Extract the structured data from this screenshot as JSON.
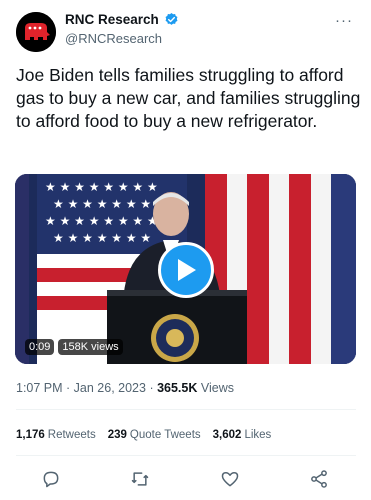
{
  "account": {
    "name": "RNC Research",
    "handle": "@RNCResearch",
    "verified": true,
    "avatar_icon": "gop-elephant-icon",
    "avatar_color": "#e0232b"
  },
  "more_menu": "···",
  "tweet": {
    "text": "Joe Biden tells families struggling to afford gas to buy a new car, and families struggling to afford food to buy a new refrigerator."
  },
  "video": {
    "duration": "0:09",
    "views": "158K views"
  },
  "meta": {
    "time": "1:07 PM",
    "sep1": " · ",
    "date": "Jan 26, 2023",
    "sep2": " · ",
    "views_count": "365.5K",
    "views_label": " Views"
  },
  "stats": [
    {
      "count": "1,176",
      "label": "Retweets"
    },
    {
      "count": "239",
      "label": "Quote Tweets"
    },
    {
      "count": "3,602",
      "label": "Likes"
    }
  ],
  "actions": [
    "reply-icon",
    "retweet-icon",
    "like-icon",
    "share-icon"
  ],
  "colors": {
    "accent": "#1d9bf0",
    "text_secondary": "#536471"
  }
}
